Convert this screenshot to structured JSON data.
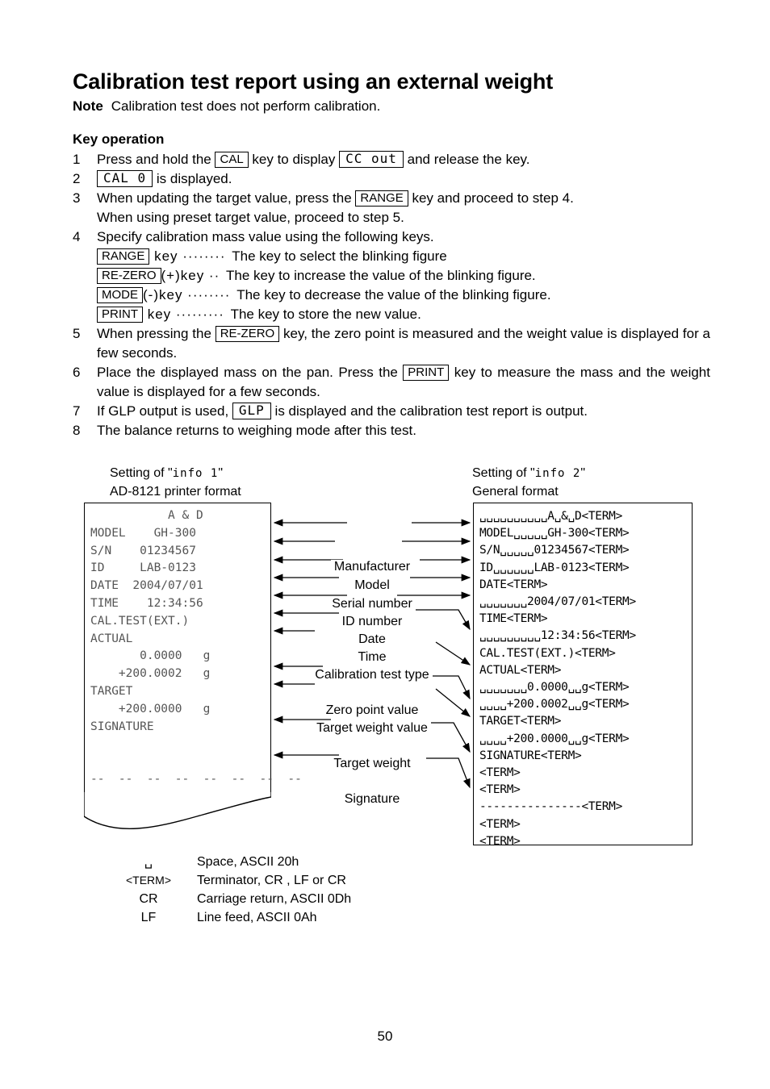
{
  "document": {
    "title": "Calibration test report using an external weight",
    "note_label": "Note",
    "note_text": "Calibration test does not perform calibration.",
    "section_heading": "Key operation",
    "page_number": "50"
  },
  "steps": [
    {
      "num": "1",
      "parts": [
        "Press and hold the ",
        "CAL",
        " key to display ",
        "CC out",
        " and release the key."
      ]
    },
    {
      "num": "2",
      "parts": [
        "",
        "CAL 0",
        " is displayed."
      ]
    },
    {
      "num": "3",
      "text_before": "When updating the target value, press the ",
      "key": "RANGE",
      "text_after": " key and proceed to step 4.",
      "continuation": "When using preset target value, proceed to step 5."
    },
    {
      "num": "4",
      "text": "Specify calibration mass value using the following keys.",
      "keylist": [
        {
          "key": "RANGE",
          "mid": " key ········ ",
          "desc": "The key to select the blinking figure"
        },
        {
          "key": "RE-ZERO",
          "mid": "(+)key ·· ",
          "desc": "The key to increase the value of the blinking figure."
        },
        {
          "key": "MODE",
          "mid": "(-)key ········ ",
          "desc": "The key to decrease the value of the blinking figure."
        },
        {
          "key": "PRINT",
          "mid": " key ········· ",
          "desc": "The key to store the new value."
        }
      ]
    },
    {
      "num": "5",
      "text_before": "When pressing the ",
      "key": "RE-ZERO",
      "text_after": " key, the zero point is measured and the weight value is displayed for a few seconds."
    },
    {
      "num": "6",
      "text_before": "Place the displayed mass on the pan. Press the ",
      "key": "PRINT",
      "text_after": " key to measure the mass and the weight value is displayed for a few seconds."
    },
    {
      "num": "7",
      "text_before": "If GLP output is used, ",
      "lcd": "GLP",
      "text_after": " is displayed and the calibration test report is output."
    },
    {
      "num": "8",
      "text": "The balance returns to weighing mode after this test."
    }
  ],
  "diagram": {
    "left_panel": {
      "caption_prefix": "Setting of \"",
      "caption_seg": "info 1",
      "caption_suffix": "\"",
      "caption_line2": "AD-8121 printer format",
      "lines": [
        "           A & D",
        "MODEL    GH-300",
        "S/N    01234567",
        "ID     LAB-0123",
        "DATE  2004/07/01",
        "TIME    12:34:56",
        "CAL.TEST(EXT.)",
        "ACTUAL",
        "       0.0000   g",
        "    +200.0002   g",
        "TARGET",
        "    +200.0000   g",
        "SIGNATURE",
        "",
        "",
        "--  --  --  --  --  --  --  --"
      ]
    },
    "right_panel": {
      "caption_prefix": "Setting of \"",
      "caption_seg": "info 2",
      "caption_suffix": "\"",
      "caption_line2": "General format",
      "lines": [
        "␣␣␣␣␣␣␣␣␣␣A␣&␣D<TERM>",
        "MODEL␣␣␣␣␣GH-300<TERM>",
        "S/N␣␣␣␣␣01234567<TERM>",
        "ID␣␣␣␣␣␣LAB-0123<TERM>",
        "DATE<TERM>",
        "␣␣␣␣␣␣␣2004/07/01<TERM>",
        "TIME<TERM>",
        "␣␣␣␣␣␣␣␣␣12:34:56<TERM>",
        "CAL.TEST(EXT.)<TERM>",
        "ACTUAL<TERM>",
        "␣␣␣␣␣␣␣0.0000␣␣g<TERM>",
        "␣␣␣␣+200.0002␣␣g<TERM>",
        "TARGET<TERM>",
        "␣␣␣␣+200.0000␣␣g<TERM>",
        "SIGNATURE<TERM>",
        "<TERM>",
        "<TERM>",
        "---------------<TERM>",
        "<TERM>",
        "<TERM>"
      ]
    },
    "callouts": [
      "Manufacturer",
      "Model",
      "Serial number",
      "ID number",
      "Date",
      "Time",
      "Calibration test type",
      "Zero point value",
      "Target weight value",
      "Target weight",
      "Signature"
    ]
  },
  "legend": [
    {
      "symbol": "␣",
      "description": "Space, ASCII 20h"
    },
    {
      "symbol": "<TERM>",
      "description": "Terminator, CR , LF or CR"
    },
    {
      "symbol": "CR",
      "description": "Carriage return, ASCII 0Dh"
    },
    {
      "symbol": "LF",
      "description": "Line feed, ASCII 0Ah"
    }
  ]
}
